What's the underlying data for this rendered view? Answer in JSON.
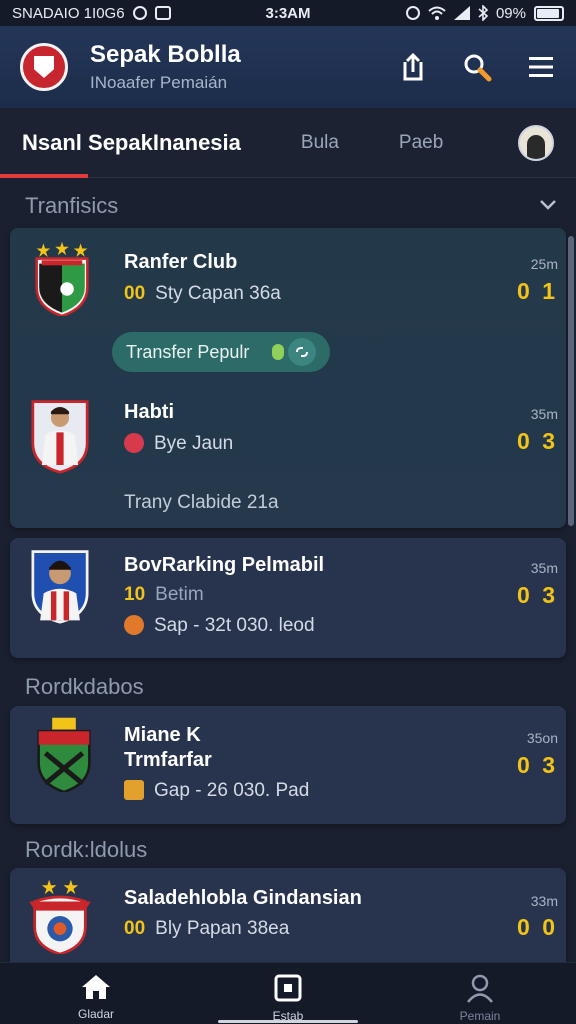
{
  "status_bar": {
    "carrier": "SNADAIO 1I0G6",
    "time": "3:3AM",
    "battery": "09%"
  },
  "header": {
    "title": "Sepak Boblla",
    "subtitle": "INoaafer Pemaián"
  },
  "tabs": [
    {
      "label": "Nsanl SepakInanesia",
      "active": true
    },
    {
      "label": "Bula",
      "active": false
    },
    {
      "label": "Paeb",
      "active": false
    }
  ],
  "sections": {
    "first": "Tranfisics",
    "second": "Rordkdabos",
    "third": "Rordk:ldolus"
  },
  "transfer_pill": {
    "label": "Transfer Pepulr"
  },
  "rows": [
    {
      "title": "Ranfer Club",
      "sub_num": "00",
      "sub_text": "Sty Capan 36a",
      "time": "25m",
      "score": "0 1"
    },
    {
      "title": "Habti",
      "sub_text": "Bye Jaun",
      "extra": "Trany Clabide 21a",
      "time": "35m",
      "score": "0 3"
    },
    {
      "title": "BovRarking Pelmabil",
      "sub_num": "10",
      "sub_text": "Betim",
      "detail": "Sap - 32t  030. leod",
      "time": "35m",
      "score": "0 3"
    },
    {
      "title": "Miane K",
      "title2": "Trmfarfar",
      "detail": "Gap - 26  030. Pad",
      "time": "35on",
      "score": "0 3"
    },
    {
      "title": "Saladehlobla Gindansian",
      "sub_num": "00",
      "sub_text": "Bly Papan 38ea",
      "time": "33m",
      "score": "0 0"
    }
  ],
  "colors": {
    "accent_red": "#e43a3a",
    "score_yellow": "#f2c318",
    "header_blue": "#243658",
    "card_bg": "#28334d"
  },
  "bottom_nav": [
    {
      "label": "Gladar",
      "icon": "home-icon"
    },
    {
      "label": "Estab",
      "icon": "square-icon"
    },
    {
      "label": "Pemain",
      "icon": "person-icon"
    }
  ]
}
